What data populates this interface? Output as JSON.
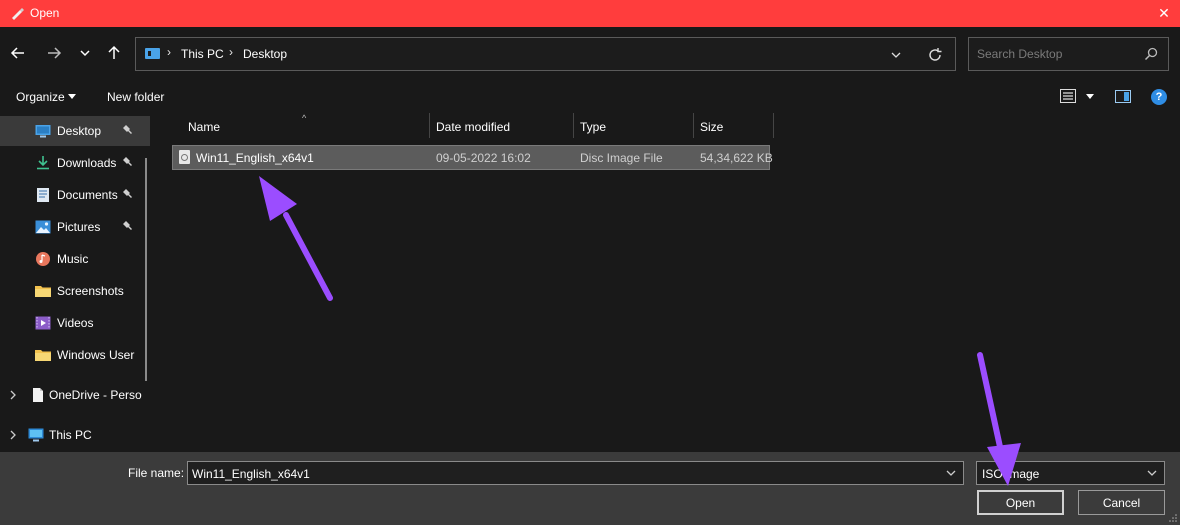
{
  "window": {
    "title": "Open"
  },
  "address": {
    "crumbs": [
      "This PC",
      "Desktop"
    ]
  },
  "search": {
    "placeholder": "Search Desktop"
  },
  "toolbar": {
    "organize_label": "Organize",
    "new_folder_label": "New folder"
  },
  "sidebar": {
    "items": [
      {
        "label": "Desktop",
        "icon": "desktop-icon",
        "pinned": true,
        "selected": true
      },
      {
        "label": "Downloads",
        "icon": "download-icon",
        "pinned": true
      },
      {
        "label": "Documents",
        "icon": "document-icon",
        "pinned": true
      },
      {
        "label": "Pictures",
        "icon": "picture-icon",
        "pinned": true
      },
      {
        "label": "Music",
        "icon": "music-icon",
        "pinned": false
      },
      {
        "label": "Screenshots",
        "icon": "folder-icon",
        "pinned": false
      },
      {
        "label": "Videos",
        "icon": "video-icon",
        "pinned": false
      },
      {
        "label": "Windows User",
        "icon": "folder-icon",
        "pinned": false
      },
      {
        "label": "OneDrive - Perso",
        "icon": "onedrive-icon",
        "expandable": true
      },
      {
        "label": "This PC",
        "icon": "pc-icon",
        "expandable": true
      }
    ]
  },
  "filelist": {
    "columns": [
      "Name",
      "Date modified",
      "Type",
      "Size"
    ],
    "rows": [
      {
        "name": "Win11_English_x64v1",
        "date": "09-05-2022 16:02",
        "type": "Disc Image File",
        "size": "54,34,622 KB",
        "selected": true
      }
    ]
  },
  "footer": {
    "file_name_label": "File name:",
    "file_name_value": "Win11_English_x64v1",
    "file_type_value": "ISO Image",
    "open_label": "Open",
    "cancel_label": "Cancel"
  },
  "colors": {
    "titlebar": "#ff3d3d",
    "background": "#191919",
    "footer": "#3b3b3b",
    "selection": "#5c5c5c",
    "annotation_arrow": "#9b4dff"
  }
}
